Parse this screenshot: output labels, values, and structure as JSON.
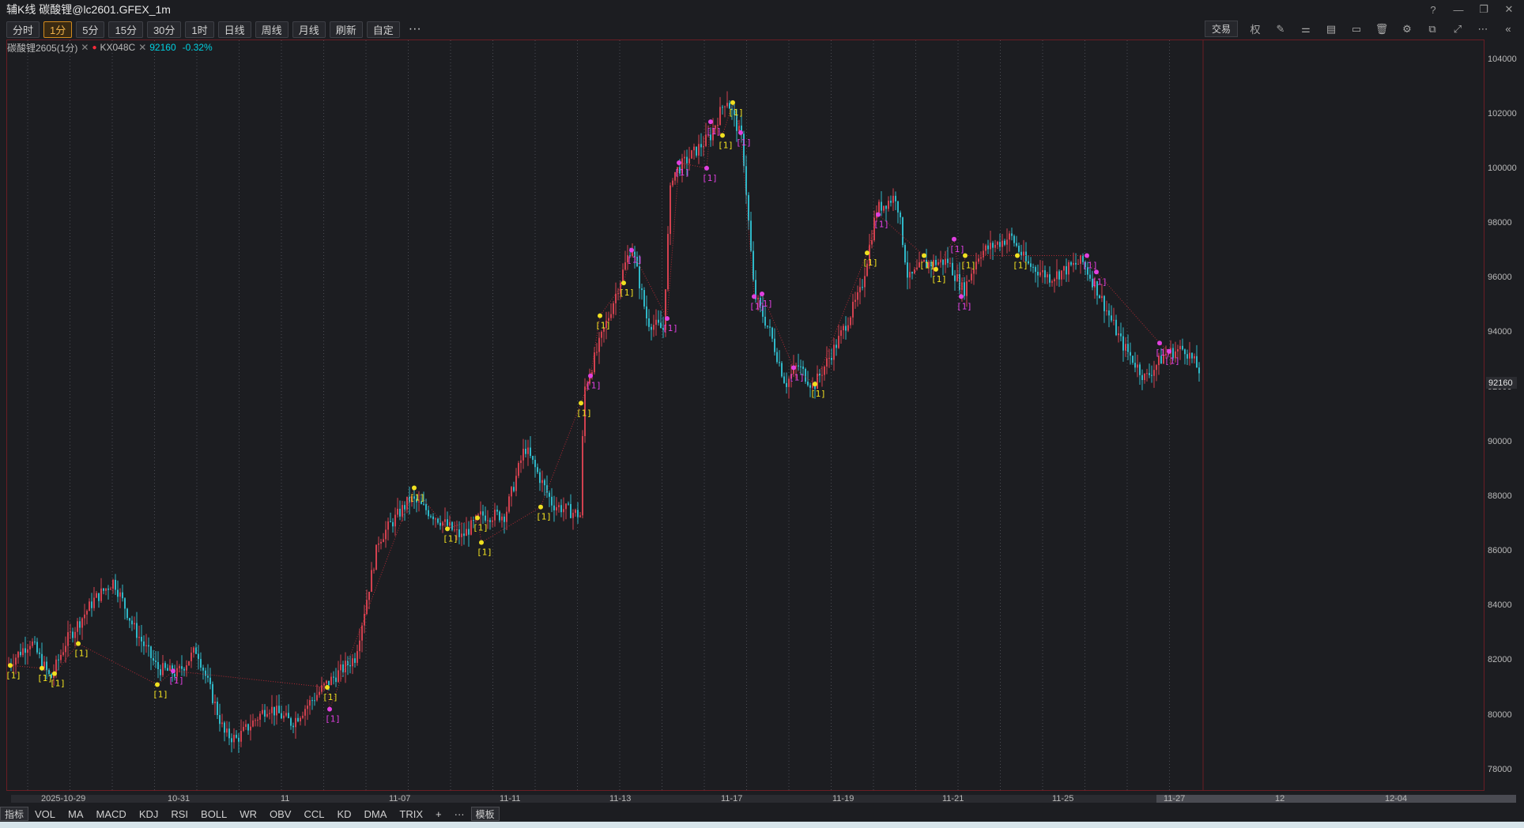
{
  "window": {
    "title": "辅K线 碳酸锂@lc2601.GFEX_1m"
  },
  "toolbar": {
    "periods": [
      {
        "label": "分时",
        "active": false
      },
      {
        "label": "1分",
        "active": true
      },
      {
        "label": "5分",
        "active": false
      },
      {
        "label": "15分",
        "active": false
      },
      {
        "label": "30分",
        "active": false
      },
      {
        "label": "1时",
        "active": false
      },
      {
        "label": "日线",
        "active": false
      },
      {
        "label": "周线",
        "active": false
      },
      {
        "label": "月线",
        "active": false
      },
      {
        "label": "刷新",
        "active": false
      },
      {
        "label": "自定",
        "active": false
      }
    ],
    "more": "···",
    "trade_label": "交易",
    "right_icons": [
      "weight-icon",
      "pen-icon",
      "sliders-icon",
      "layout-icon",
      "window-icon",
      "trash-icon",
      "settings-icon",
      "copy-icon",
      "fullscreen-icon",
      "more-icon",
      "collapse-icon"
    ],
    "weight_label": "权"
  },
  "legend": {
    "name": "碳酸锂2605(1分)",
    "indicator": "KX048C",
    "price": "92160",
    "change": "-0.32%"
  },
  "chart_data": {
    "type": "candlestick",
    "y_ticks": [
      104000,
      102000,
      100000,
      98000,
      96000,
      94000,
      92000,
      90000,
      88000,
      86000,
      84000,
      82000,
      80000,
      78000
    ],
    "ylim": [
      77500,
      104500
    ],
    "last_price": "92160",
    "x_labels": [
      "2025-10-29",
      "10-31",
      "11",
      "11-07",
      "11-11",
      "11-13",
      "11-17",
      "11-19",
      "11-21",
      "11-25",
      "11-27",
      "12",
      "12-04"
    ],
    "path_anchors": [
      [
        0,
        81800
      ],
      [
        30,
        82700
      ],
      [
        55,
        81300
      ],
      [
        75,
        82700
      ],
      [
        110,
        84200
      ],
      [
        135,
        84900
      ],
      [
        160,
        83200
      ],
      [
        190,
        81700
      ],
      [
        215,
        81500
      ],
      [
        240,
        82400
      ],
      [
        275,
        79300
      ],
      [
        290,
        79100
      ],
      [
        330,
        80300
      ],
      [
        360,
        79700
      ],
      [
        400,
        81000
      ],
      [
        440,
        82100
      ],
      [
        470,
        86400
      ],
      [
        510,
        87900
      ],
      [
        540,
        87300
      ],
      [
        575,
        86500
      ],
      [
        600,
        87300
      ],
      [
        630,
        87300
      ],
      [
        655,
        89800
      ],
      [
        690,
        87700
      ],
      [
        725,
        87300
      ],
      [
        730,
        91900
      ],
      [
        760,
        94500
      ],
      [
        790,
        97200
      ],
      [
        810,
        94400
      ],
      [
        830,
        94100
      ],
      [
        840,
        99700
      ],
      [
        870,
        100600
      ],
      [
        890,
        101200
      ],
      [
        910,
        102600
      ],
      [
        930,
        101000
      ],
      [
        945,
        95400
      ],
      [
        965,
        94000
      ],
      [
        985,
        92100
      ],
      [
        1000,
        92800
      ],
      [
        1020,
        92000
      ],
      [
        1050,
        93600
      ],
      [
        1080,
        95500
      ],
      [
        1100,
        98500
      ],
      [
        1125,
        99000
      ],
      [
        1140,
        95900
      ],
      [
        1160,
        96500
      ],
      [
        1190,
        96600
      ],
      [
        1210,
        95500
      ],
      [
        1230,
        96900
      ],
      [
        1270,
        97500
      ],
      [
        1290,
        96500
      ],
      [
        1320,
        96000
      ],
      [
        1360,
        96600
      ],
      [
        1380,
        95500
      ],
      [
        1410,
        93600
      ],
      [
        1440,
        92300
      ],
      [
        1465,
        93200
      ],
      [
        1490,
        93400
      ],
      [
        1515,
        92300
      ]
    ]
  }
}
